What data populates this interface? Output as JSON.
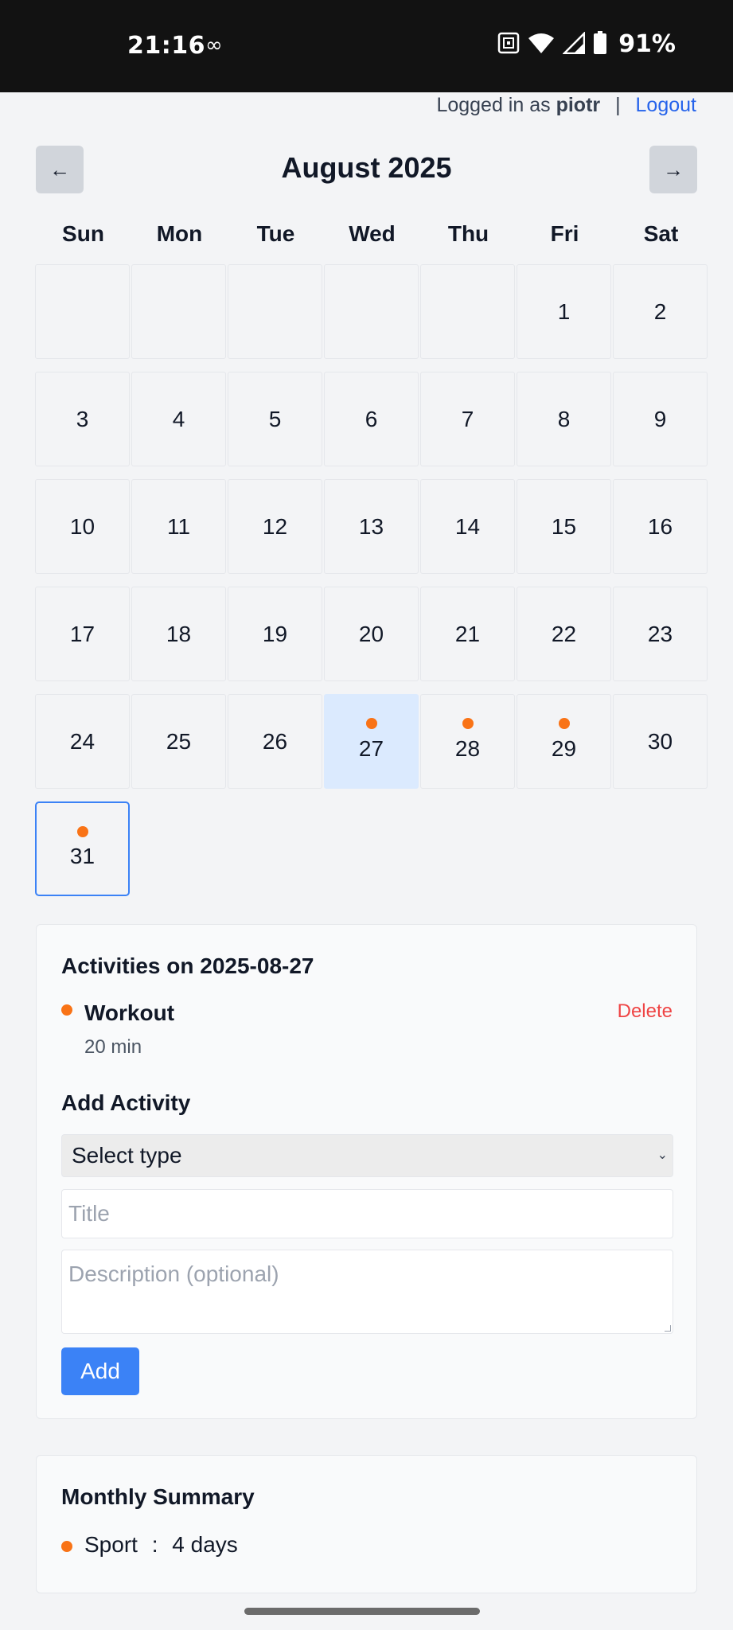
{
  "status_bar": {
    "time": "21:16",
    "loop_icon": "∞",
    "battery_percent": "91%",
    "icons": [
      "nfc-icon",
      "wifi-icon",
      "signal-icon",
      "battery-icon"
    ]
  },
  "header": {
    "logged_in_prefix": "Logged in as",
    "username": "piotr",
    "separator": "|",
    "logout_label": "Logout"
  },
  "calendar": {
    "prev_label": "←",
    "next_label": "→",
    "month_title": "August 2025",
    "weekdays": [
      "Sun",
      "Mon",
      "Tue",
      "Wed",
      "Thu",
      "Fri",
      "Sat"
    ],
    "leading_empty_cells": 5,
    "days_in_month": 31,
    "selected_day": 27,
    "today_day": 31,
    "days_with_activity": [
      27,
      28,
      29,
      31
    ]
  },
  "activities": {
    "title": "Activities on 2025-08-27",
    "items": [
      {
        "name": "Workout",
        "duration": "20 min",
        "delete_label": "Delete"
      }
    ]
  },
  "add_activity": {
    "title": "Add Activity",
    "type_select_value": "Select type",
    "title_placeholder": "Title",
    "description_placeholder": "Description (optional)",
    "add_label": "Add"
  },
  "summary": {
    "title": "Monthly Summary",
    "items": [
      {
        "label": "Sport",
        "separator": ":",
        "value": "4 days"
      }
    ]
  },
  "colors": {
    "accent": "#3b82f6",
    "activity_dot": "#f97316",
    "delete": "#ef4444",
    "selected_day_bg": "#dbeafe"
  }
}
